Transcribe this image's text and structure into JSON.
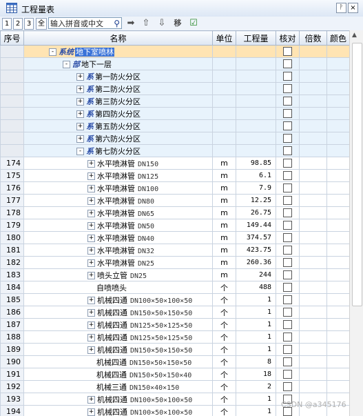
{
  "window": {
    "title": "工程量表",
    "pin_icon": "pin-icon",
    "close_icon": "close-icon"
  },
  "toolbar": {
    "levels": [
      "1",
      "2",
      "3",
      "全"
    ],
    "search_placeholder": "输入拼音或中文",
    "search_icon": "magnifier-icon",
    "actions": [
      {
        "name": "go-icon",
        "glyph": "➡"
      },
      {
        "name": "move-up-icon",
        "glyph": "⇧"
      },
      {
        "name": "move-down-icon",
        "glyph": "⇩"
      },
      {
        "name": "move-label",
        "glyph": "移"
      },
      {
        "name": "check-list-icon",
        "glyph": "☑"
      }
    ]
  },
  "columns": [
    "序号",
    "名称",
    "单位",
    "工程量",
    "核对",
    "倍数",
    "颜色"
  ],
  "rows": [
    {
      "seq": "",
      "depth": 0,
      "expander": "-",
      "type_icon": "系统",
      "name": "地下室喷林",
      "spec": "",
      "unit": "",
      "qty": "",
      "group": true,
      "selected": true
    },
    {
      "seq": "",
      "depth": 1,
      "expander": "-",
      "type_icon": "部",
      "name": "地下一层",
      "spec": "",
      "unit": "",
      "qty": "",
      "group": true
    },
    {
      "seq": "",
      "depth": 2,
      "expander": "+",
      "type_icon": "系",
      "name": "第一防火分区",
      "spec": "",
      "unit": "",
      "qty": "",
      "group": true
    },
    {
      "seq": "",
      "depth": 2,
      "expander": "+",
      "type_icon": "系",
      "name": "第二防火分区",
      "spec": "",
      "unit": "",
      "qty": "",
      "group": true
    },
    {
      "seq": "",
      "depth": 2,
      "expander": "+",
      "type_icon": "系",
      "name": "第三防火分区",
      "spec": "",
      "unit": "",
      "qty": "",
      "group": true
    },
    {
      "seq": "",
      "depth": 2,
      "expander": "+",
      "type_icon": "系",
      "name": "第四防火分区",
      "spec": "",
      "unit": "",
      "qty": "",
      "group": true
    },
    {
      "seq": "",
      "depth": 2,
      "expander": "+",
      "type_icon": "系",
      "name": "第五防火分区",
      "spec": "",
      "unit": "",
      "qty": "",
      "group": true
    },
    {
      "seq": "",
      "depth": 2,
      "expander": "+",
      "type_icon": "系",
      "name": "第六防火分区",
      "spec": "",
      "unit": "",
      "qty": "",
      "group": true
    },
    {
      "seq": "",
      "depth": 2,
      "expander": "-",
      "type_icon": "系",
      "name": "第七防火分区",
      "spec": "",
      "unit": "",
      "qty": "",
      "group": true
    },
    {
      "seq": "174",
      "depth": 3,
      "expander": "+",
      "name": "水平喷淋管",
      "spec": "DN150",
      "unit": "m",
      "qty": "98.85"
    },
    {
      "seq": "175",
      "depth": 3,
      "expander": "+",
      "name": "水平喷淋管",
      "spec": "DN125",
      "unit": "m",
      "qty": "6.1"
    },
    {
      "seq": "176",
      "depth": 3,
      "expander": "+",
      "name": "水平喷淋管",
      "spec": "DN100",
      "unit": "m",
      "qty": "7.9"
    },
    {
      "seq": "177",
      "depth": 3,
      "expander": "+",
      "name": "水平喷淋管",
      "spec": "DN80",
      "unit": "m",
      "qty": "12.25"
    },
    {
      "seq": "178",
      "depth": 3,
      "expander": "+",
      "name": "水平喷淋管",
      "spec": "DN65",
      "unit": "m",
      "qty": "26.75"
    },
    {
      "seq": "179",
      "depth": 3,
      "expander": "+",
      "name": "水平喷淋管",
      "spec": "DN50",
      "unit": "m",
      "qty": "149.44"
    },
    {
      "seq": "180",
      "depth": 3,
      "expander": "+",
      "name": "水平喷淋管",
      "spec": "DN40",
      "unit": "m",
      "qty": "374.57"
    },
    {
      "seq": "181",
      "depth": 3,
      "expander": "+",
      "name": "水平喷淋管",
      "spec": "DN32",
      "unit": "m",
      "qty": "423.75"
    },
    {
      "seq": "182",
      "depth": 3,
      "expander": "+",
      "name": "水平喷淋管",
      "spec": "DN25",
      "unit": "m",
      "qty": "260.36"
    },
    {
      "seq": "183",
      "depth": 3,
      "expander": "+",
      "name": "喷头立管",
      "spec": "DN25",
      "unit": "m",
      "qty": "244"
    },
    {
      "seq": "184",
      "depth": 3,
      "expander": "",
      "name": "自喷喷头",
      "spec": "",
      "unit": "个",
      "qty": "488"
    },
    {
      "seq": "185",
      "depth": 3,
      "expander": "+",
      "name": "机械四通",
      "spec": "DN100×50×100×50",
      "unit": "个",
      "qty": "1"
    },
    {
      "seq": "186",
      "depth": 3,
      "expander": "+",
      "name": "机械四通",
      "spec": "DN150×50×150×50",
      "unit": "个",
      "qty": "1"
    },
    {
      "seq": "187",
      "depth": 3,
      "expander": "+",
      "name": "机械四通",
      "spec": "DN125×50×125×50",
      "unit": "个",
      "qty": "1"
    },
    {
      "seq": "188",
      "depth": 3,
      "expander": "+",
      "name": "机械四通",
      "spec": "DN125×50×125×50",
      "unit": "个",
      "qty": "1"
    },
    {
      "seq": "189",
      "depth": 3,
      "expander": "+",
      "name": "机械四通",
      "spec": "DN150×50×150×50",
      "unit": "个",
      "qty": "1"
    },
    {
      "seq": "190",
      "depth": 3,
      "expander": "",
      "name": "机械四通",
      "spec": "DN150×50×150×50",
      "unit": "个",
      "qty": "8"
    },
    {
      "seq": "191",
      "depth": 3,
      "expander": "",
      "name": "机械四通",
      "spec": "DN150×50×150×40",
      "unit": "个",
      "qty": "18"
    },
    {
      "seq": "192",
      "depth": 3,
      "expander": "",
      "name": "机械三通",
      "spec": "DN150×40×150",
      "unit": "个",
      "qty": "2"
    },
    {
      "seq": "193",
      "depth": 3,
      "expander": "+",
      "name": "机械四通",
      "spec": "DN100×50×100×50",
      "unit": "个",
      "qty": "1"
    },
    {
      "seq": "194",
      "depth": 3,
      "expander": "+",
      "name": "机械四通",
      "spec": "DN100×50×100×50",
      "unit": "个",
      "qty": "1"
    }
  ],
  "watermark": "CSDN @a345176",
  "colors": {
    "selected_row": "#ffe4b3",
    "selection_text_bg": "#3a73d8",
    "group_row": "#e8f3fc"
  }
}
